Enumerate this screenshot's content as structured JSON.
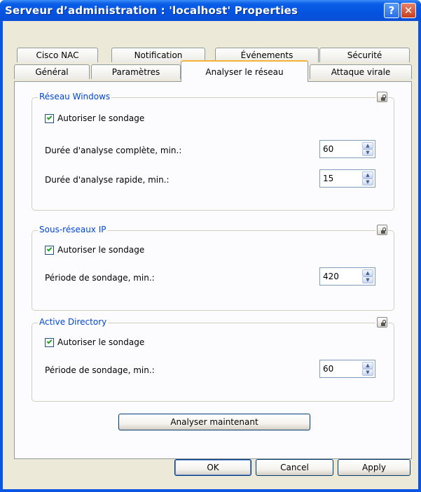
{
  "window": {
    "title": "Serveur d’administration : 'localhost' Properties"
  },
  "titlebar": {
    "help_label": "?",
    "close_label": "✕"
  },
  "tabs_row1": [
    {
      "label": "Cisco NAC"
    },
    {
      "label": "Notification"
    },
    {
      "label": "Événements"
    },
    {
      "label": "Sécurité"
    }
  ],
  "tabs_row2": [
    {
      "label": "Général"
    },
    {
      "label": "Paramètres"
    },
    {
      "label": "Analyser le réseau"
    },
    {
      "label": "Attaque virale"
    }
  ],
  "groups": {
    "windows": {
      "title": "Réseau Windows",
      "allow_probe": {
        "label": "Autoriser le sondage",
        "checked": true
      },
      "full_scan": {
        "label": "Durée d'analyse complète, min.:",
        "value": "60"
      },
      "quick_scan": {
        "label": "Durée d'analyse rapide, min.:",
        "value": "15"
      }
    },
    "ip": {
      "title": "Sous-réseaux IP",
      "allow_probe": {
        "label": "Autoriser le sondage",
        "checked": true
      },
      "period": {
        "label": "Période de sondage, min.:",
        "value": "420"
      }
    },
    "ad": {
      "title": "Active Directory",
      "allow_probe": {
        "label": "Autoriser le sondage",
        "checked": true
      },
      "period": {
        "label": "Période de sondage, min.:",
        "value": "60"
      }
    }
  },
  "buttons": {
    "scan_now": "Analyser maintenant",
    "ok": "OK",
    "cancel": "Cancel",
    "apply": "Apply"
  },
  "colors": {
    "titlebar": "#0553e0",
    "group_title": "#0046d5",
    "active_tab_accent": "#f4b23b",
    "dialog_bg": "#ece9d8"
  }
}
